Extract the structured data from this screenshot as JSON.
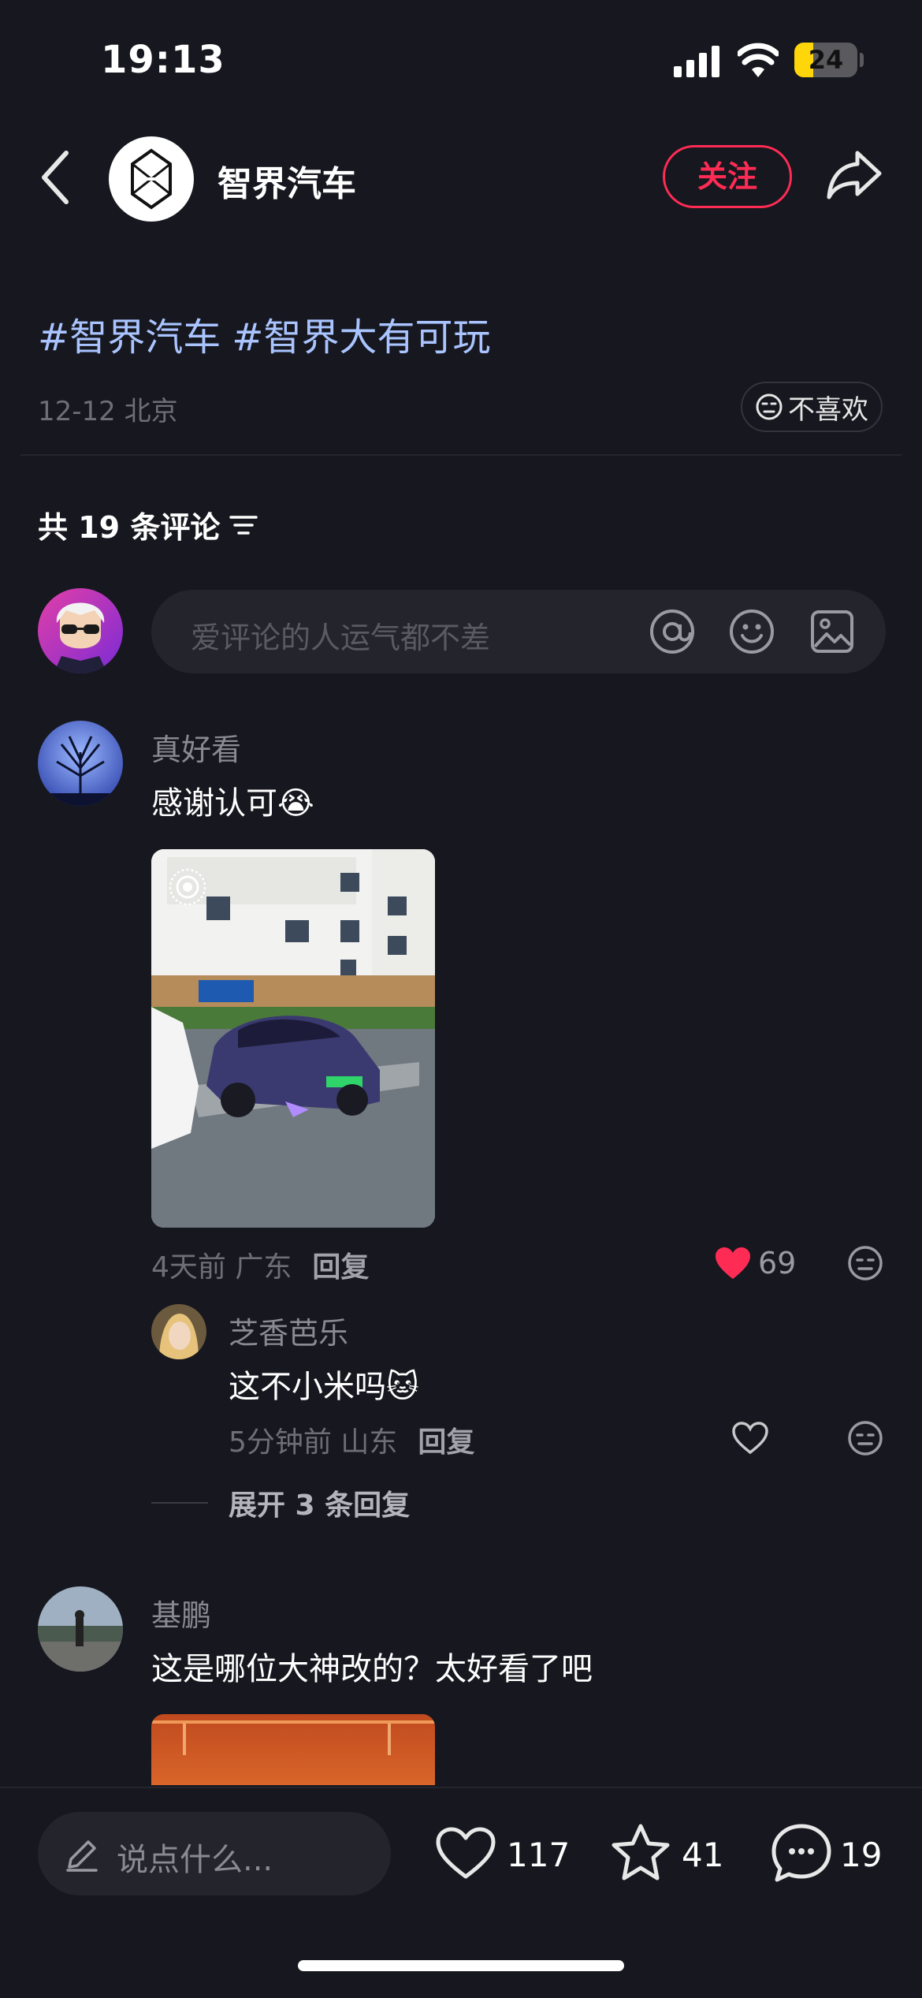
{
  "status": {
    "time": "19:13",
    "battery": "24"
  },
  "header": {
    "author": "智界汽车",
    "follow_label": "关注"
  },
  "post": {
    "tags": [
      "#智界汽车",
      "#智界大有可玩"
    ],
    "date_location": "12-12 北京",
    "dislike_label": "不喜欢"
  },
  "comments_header": {
    "label": "共 19 条评论"
  },
  "comment_input": {
    "placeholder": "爱评论的人运气都不差"
  },
  "comments": [
    {
      "user": "真好看",
      "text": "感谢认可",
      "emoji": "😭",
      "meta": "4天前 广东",
      "reply_label": "回复",
      "likes": "69",
      "liked": true
    },
    {
      "user": "基鹏",
      "text": "这是哪位大神改的？太好看了吧"
    }
  ],
  "sub_reply": {
    "user": "芝香芭乐",
    "text": "这不小米吗",
    "emoji": "🐱",
    "meta": "5分钟前 山东",
    "reply_label": "回复"
  },
  "expand_label": "展开 3 条回复",
  "bottom": {
    "say_placeholder": "说点什么...",
    "likes": "117",
    "favorites": "41",
    "comments": "19"
  },
  "colors": {
    "accent": "#fe2c55",
    "tag": "#a9c4ff",
    "background": "#17171f"
  }
}
